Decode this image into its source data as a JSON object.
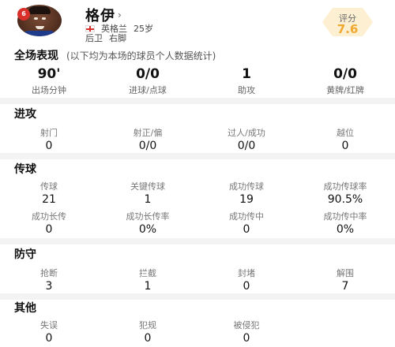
{
  "player": {
    "badge": "6",
    "name": "格伊",
    "chevron": "›",
    "nation": "英格兰",
    "age": "25岁",
    "position": "后卫",
    "foot": "右脚",
    "rating_label": "评分",
    "rating_value": "7.6"
  },
  "overall": {
    "title": "全场表现",
    "subtitle": "(以下均为本场的球员个人数据统计)",
    "items": [
      {
        "value": "90'",
        "label": "出场分钟"
      },
      {
        "value": "0/0",
        "label": "进球/点球"
      },
      {
        "value": "1",
        "label": "助攻"
      },
      {
        "value": "0/0",
        "label": "黄牌/红牌"
      }
    ]
  },
  "sections": [
    {
      "title": "进攻",
      "rows": [
        [
          {
            "label": "射门",
            "value": "0"
          },
          {
            "label": "射正/偏",
            "value": "0/0"
          },
          {
            "label": "过人/成功",
            "value": "0/0"
          },
          {
            "label": "越位",
            "value": "0"
          }
        ]
      ]
    },
    {
      "title": "传球",
      "rows": [
        [
          {
            "label": "传球",
            "value": "21"
          },
          {
            "label": "关键传球",
            "value": "1"
          },
          {
            "label": "成功传球",
            "value": "19"
          },
          {
            "label": "成功传球率",
            "value": "90.5%"
          }
        ],
        [
          {
            "label": "成功长传",
            "value": "0"
          },
          {
            "label": "成功长传率",
            "value": "0%"
          },
          {
            "label": "成功传中",
            "value": "0"
          },
          {
            "label": "成功传中率",
            "value": "0%"
          }
        ]
      ]
    },
    {
      "title": "防守",
      "rows": [
        [
          {
            "label": "抢断",
            "value": "3"
          },
          {
            "label": "拦截",
            "value": "1"
          },
          {
            "label": "封堵",
            "value": "0"
          },
          {
            "label": "解围",
            "value": "7"
          }
        ]
      ]
    },
    {
      "title": "其他",
      "rows": [
        [
          {
            "label": "失误",
            "value": "0"
          },
          {
            "label": "犯规",
            "value": "0"
          },
          {
            "label": "被侵犯",
            "value": "0"
          }
        ]
      ]
    }
  ],
  "colors": {
    "accent": "#f0a830",
    "badge": "#d9302c",
    "divider": "#f3f3f3"
  }
}
